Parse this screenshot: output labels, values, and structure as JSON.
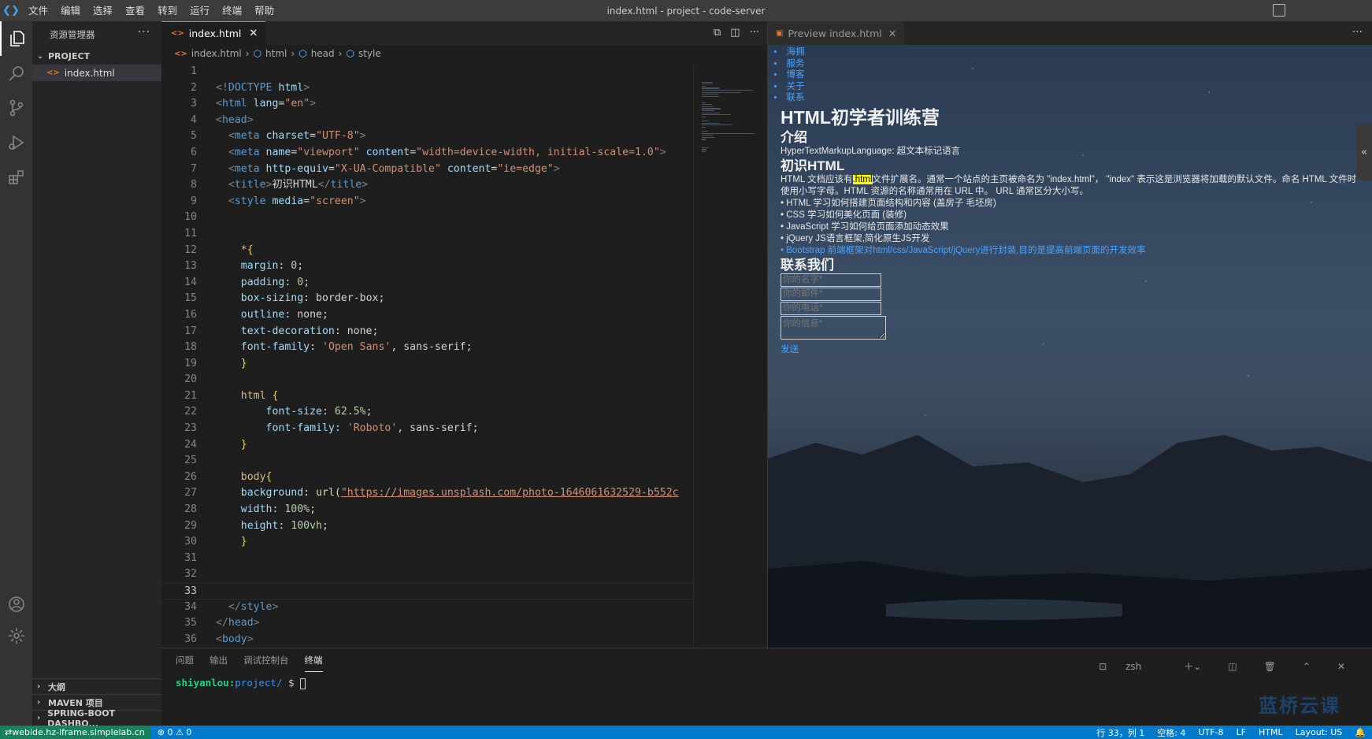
{
  "titlebar": {
    "title": "index.html - project - code-server",
    "menu": [
      "文件",
      "编辑",
      "选择",
      "查看",
      "转到",
      "运行",
      "终端",
      "帮助"
    ]
  },
  "sidebar": {
    "title": "资源管理器",
    "project_label": "PROJECT",
    "file": "index.html",
    "bottom_sections": [
      "大纲",
      "MAVEN 项目",
      "SPRING-BOOT DASHBO..."
    ]
  },
  "editor": {
    "tab_label": "index.html",
    "breadcrumb": [
      "index.html",
      "html",
      "head",
      "style"
    ],
    "lines": [
      [],
      [
        [
          "t-br",
          "<!"
        ],
        [
          "t-tag",
          "DOCTYPE "
        ],
        [
          "t-attr",
          "html"
        ],
        [
          "t-br",
          ">"
        ]
      ],
      [
        [
          "t-br",
          "<"
        ],
        [
          "t-tag",
          "html "
        ],
        [
          "t-attr",
          "lang"
        ],
        [
          "t-pl",
          "="
        ],
        [
          "t-str",
          "\"en\""
        ],
        [
          "t-br",
          ">"
        ]
      ],
      [
        [
          "t-br",
          "<"
        ],
        [
          "t-tag",
          "head"
        ],
        [
          "t-br",
          ">"
        ]
      ],
      [
        [
          "t-pl",
          "  "
        ],
        [
          "t-br",
          "<"
        ],
        [
          "t-tag",
          "meta "
        ],
        [
          "t-attr",
          "charset"
        ],
        [
          "t-pl",
          "="
        ],
        [
          "t-str",
          "\"UTF-8\""
        ],
        [
          "t-br",
          ">"
        ]
      ],
      [
        [
          "t-pl",
          "  "
        ],
        [
          "t-br",
          "<"
        ],
        [
          "t-tag",
          "meta "
        ],
        [
          "t-attr",
          "name"
        ],
        [
          "t-pl",
          "="
        ],
        [
          "t-str",
          "\"viewport\" "
        ],
        [
          "t-attr",
          "content"
        ],
        [
          "t-pl",
          "="
        ],
        [
          "t-str",
          "\"width=device-width, initial-scale=1.0\""
        ],
        [
          "t-br",
          ">"
        ]
      ],
      [
        [
          "t-pl",
          "  "
        ],
        [
          "t-br",
          "<"
        ],
        [
          "t-tag",
          "meta "
        ],
        [
          "t-attr",
          "http-equiv"
        ],
        [
          "t-pl",
          "="
        ],
        [
          "t-str",
          "\"X-UA-Compatible\" "
        ],
        [
          "t-attr",
          "content"
        ],
        [
          "t-pl",
          "="
        ],
        [
          "t-str",
          "\"ie=edge\""
        ],
        [
          "t-br",
          ">"
        ]
      ],
      [
        [
          "t-pl",
          "  "
        ],
        [
          "t-br",
          "<"
        ],
        [
          "t-tag",
          "title"
        ],
        [
          "t-br",
          ">"
        ],
        [
          "t-pl",
          "初识HTML"
        ],
        [
          "t-br",
          "</"
        ],
        [
          "t-tag",
          "title"
        ],
        [
          "t-br",
          ">"
        ]
      ],
      [
        [
          "t-pl",
          "  "
        ],
        [
          "t-br",
          "<"
        ],
        [
          "t-tag",
          "style "
        ],
        [
          "t-attr",
          "media"
        ],
        [
          "t-pl",
          "="
        ],
        [
          "t-str",
          "\"screen\""
        ],
        [
          "t-br",
          ">"
        ]
      ],
      [],
      [],
      [
        [
          "t-pl",
          "    "
        ],
        [
          "t-sel",
          "*"
        ],
        [
          "t-brace",
          "{"
        ]
      ],
      [
        [
          "t-pl",
          "    "
        ],
        [
          "t-prop",
          "margin"
        ],
        [
          "t-pl",
          ": "
        ],
        [
          "t-num",
          "0"
        ],
        [
          "t-pl",
          ";"
        ]
      ],
      [
        [
          "t-pl",
          "    "
        ],
        [
          "t-prop",
          "padding"
        ],
        [
          "t-pl",
          ": "
        ],
        [
          "t-num",
          "0"
        ],
        [
          "t-pl",
          ";"
        ]
      ],
      [
        [
          "t-pl",
          "    "
        ],
        [
          "t-prop",
          "box-sizing"
        ],
        [
          "t-pl",
          ": border-box;"
        ]
      ],
      [
        [
          "t-pl",
          "    "
        ],
        [
          "t-prop",
          "outline"
        ],
        [
          "t-pl",
          ": none;"
        ]
      ],
      [
        [
          "t-pl",
          "    "
        ],
        [
          "t-prop",
          "text-decoration"
        ],
        [
          "t-pl",
          ": none;"
        ]
      ],
      [
        [
          "t-pl",
          "    "
        ],
        [
          "t-prop",
          "font-family"
        ],
        [
          "t-pl",
          ": "
        ],
        [
          "t-str",
          "'Open Sans'"
        ],
        [
          "t-pl",
          ", sans-serif;"
        ]
      ],
      [
        [
          "t-pl",
          "    "
        ],
        [
          "t-brace",
          "}"
        ]
      ],
      [],
      [
        [
          "t-pl",
          "    "
        ],
        [
          "t-sel",
          "html "
        ],
        [
          "t-brace",
          "{"
        ]
      ],
      [
        [
          "t-pl",
          "        "
        ],
        [
          "t-prop",
          "font-size"
        ],
        [
          "t-pl",
          ": "
        ],
        [
          "t-num",
          "62.5%"
        ],
        [
          "t-pl",
          ";"
        ]
      ],
      [
        [
          "t-pl",
          "        "
        ],
        [
          "t-prop",
          "font-family"
        ],
        [
          "t-pl",
          ": "
        ],
        [
          "t-str",
          "'Roboto'"
        ],
        [
          "t-pl",
          ", sans-serif;"
        ]
      ],
      [
        [
          "t-pl",
          "    "
        ],
        [
          "t-brace",
          "}"
        ]
      ],
      [],
      [
        [
          "t-pl",
          "    "
        ],
        [
          "t-sel",
          "body"
        ],
        [
          "t-brace",
          "{"
        ]
      ],
      [
        [
          "t-pl",
          "    "
        ],
        [
          "t-prop",
          "background"
        ],
        [
          "t-pl",
          ": "
        ],
        [
          "t-fn",
          "url"
        ],
        [
          "t-pl",
          "("
        ],
        [
          "t-url",
          "\"https://images.unsplash.com/photo-1646061632529-b552c"
        ]
      ],
      [
        [
          "t-pl",
          "    "
        ],
        [
          "t-prop",
          "width"
        ],
        [
          "t-pl",
          ": "
        ],
        [
          "t-num",
          "100%"
        ],
        [
          "t-pl",
          ";"
        ]
      ],
      [
        [
          "t-pl",
          "    "
        ],
        [
          "t-prop",
          "height"
        ],
        [
          "t-pl",
          ": "
        ],
        [
          "t-num",
          "100vh"
        ],
        [
          "t-pl",
          ";"
        ]
      ],
      [
        [
          "t-pl",
          "    "
        ],
        [
          "t-brace",
          "}"
        ]
      ],
      [],
      [],
      [],
      [
        [
          "t-pl",
          "  "
        ],
        [
          "t-br",
          "</"
        ],
        [
          "t-tag",
          "style"
        ],
        [
          "t-br",
          ">"
        ]
      ],
      [
        [
          "t-br",
          "</"
        ],
        [
          "t-tag",
          "head"
        ],
        [
          "t-br",
          ">"
        ]
      ],
      [
        [
          "t-br",
          "<"
        ],
        [
          "t-tag",
          "body"
        ],
        [
          "t-br",
          ">"
        ]
      ]
    ],
    "current_line": 33
  },
  "preview": {
    "tab_label": "Preview index.html",
    "nav": [
      "海拥",
      "服务",
      "博客",
      "关于",
      "联系"
    ],
    "h1": "HTML初学者训练营",
    "h2_intro": "介绍",
    "intro_text": "HyperTextMarkupLanguage: 超文本标记语言",
    "h2_know": "初识HTML",
    "para_a": "HTML 文档应该有",
    "para_hl": ".html",
    "para_b": "文件扩展名。通常一个站点的主页被命名为 \"index.html\"， \"index\" 表示这是浏览器将加载的默认文件。命名 HTML 文件时使用小写字母。HTML 资源的名称通常用在 URL 中。 URL 通常区分大小写。",
    "list": [
      "HTML 学习如何搭建页面结构和内容 (盖房子 毛坯房)",
      "CSS 学习如何美化页面 (装修)",
      "JavaScript 学习如何给页面添加动态效果",
      "jQuery JS语言框架,简化原生JS开发"
    ],
    "list_link": "Bootstrap 前端框架对html/css/JavaScript/jQuery进行封装,目的是提高前端页面的开发效率",
    "h2_contact": "联系我们",
    "ph_name": "你的名字*",
    "ph_mail": "你的邮件*",
    "ph_phone": "你的电话*",
    "ph_msg": "你的信息*",
    "send": "发送"
  },
  "panel": {
    "tabs": [
      "问题",
      "输出",
      "调试控制台",
      "终端"
    ],
    "active_tab": "终端",
    "shell": "zsh",
    "prompt_user": "shiyanlou",
    "prompt_path": "project/",
    "prompt_symbol": "$"
  },
  "watermark": "蓝桥云课",
  "status": {
    "remote": "webide.hz-iframe.simplelab.cn",
    "errors": "0",
    "warnings": "0",
    "position": "行 33，列 1",
    "spaces": "空格: 4",
    "encoding": "UTF-8",
    "eol": "LF",
    "language": "HTML",
    "layout": "Layout: US"
  }
}
